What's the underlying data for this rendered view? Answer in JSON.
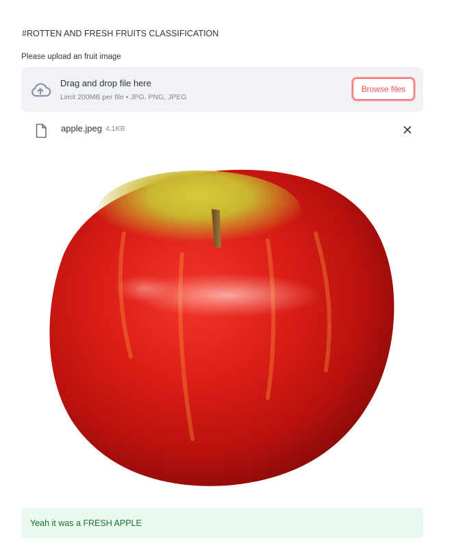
{
  "app": {
    "title": "#ROTTEN AND FRESH FRUITS CLASSIFICATION"
  },
  "uploader": {
    "label": "Please upload an fruit image",
    "drop_text": "Drag and drop file here",
    "limit_text": "Limit 200MB per file • JPG, PNG, JPEG",
    "browse_label": "Browse files",
    "icon": "cloud-upload-icon"
  },
  "file": {
    "name": "apple.jpeg",
    "size": "4.1KB",
    "icon": "file-icon",
    "remove_icon": "close-icon"
  },
  "image": {
    "subject": "red apple"
  },
  "result": {
    "text": "Yeah it was a FRESH APPLE"
  },
  "colors": {
    "accent": "#ff4b4b",
    "dropzone_bg": "#f0f2f6",
    "success_bg": "#e9f9ee",
    "success_text": "#177233",
    "text": "#31333f",
    "muted": "#808495"
  }
}
